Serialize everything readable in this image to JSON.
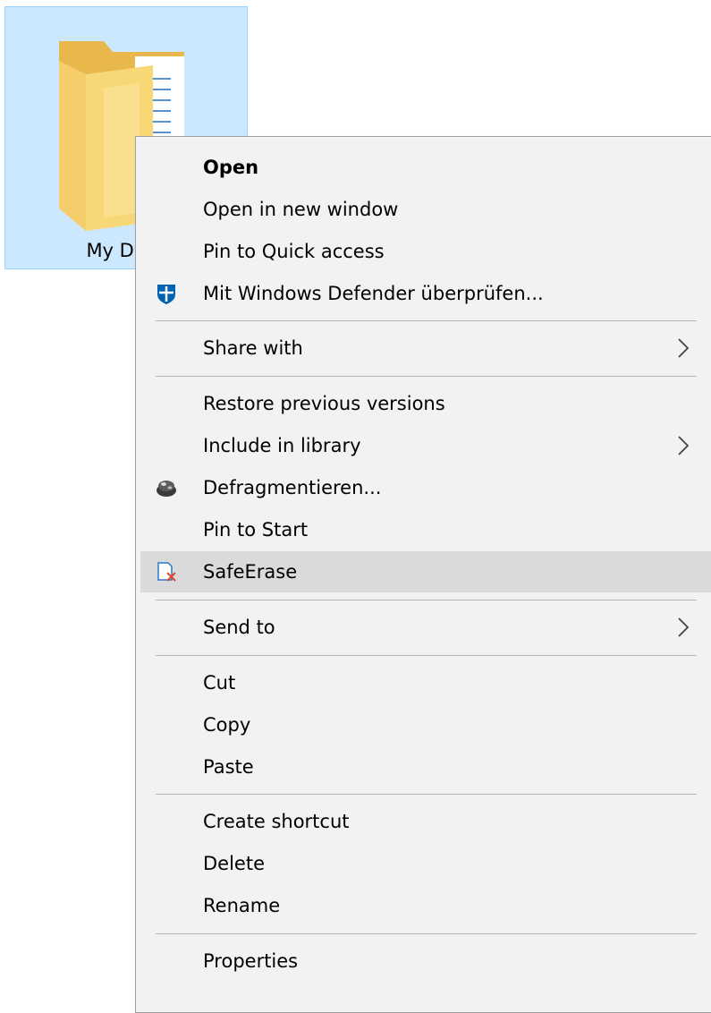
{
  "desktop": {
    "folder_label": "My Docu"
  },
  "context_menu": {
    "items": [
      {
        "id": "open",
        "label": "Open"
      },
      {
        "id": "open-new-window",
        "label": "Open in new window"
      },
      {
        "id": "pin-quick-access",
        "label": "Pin to Quick access"
      },
      {
        "id": "defender-scan",
        "label": "Mit Windows Defender überprüfen...",
        "icon": "windows-defender-shield-icon"
      },
      {
        "id": "share-with",
        "label": "Share with",
        "submenu": true
      },
      {
        "id": "restore-versions",
        "label": "Restore previous versions"
      },
      {
        "id": "include-library",
        "label": "Include in library",
        "submenu": true
      },
      {
        "id": "defragment",
        "label": "Defragmentieren...",
        "icon": "defrag-icon"
      },
      {
        "id": "pin-start",
        "label": "Pin to Start"
      },
      {
        "id": "safe-erase",
        "label": "SafeErase",
        "icon": "safeerase-icon",
        "highlighted": true
      },
      {
        "id": "send-to",
        "label": "Send to",
        "submenu": true
      },
      {
        "id": "cut",
        "label": "Cut"
      },
      {
        "id": "copy",
        "label": "Copy"
      },
      {
        "id": "paste",
        "label": "Paste"
      },
      {
        "id": "create-shortcut",
        "label": "Create shortcut"
      },
      {
        "id": "delete",
        "label": "Delete"
      },
      {
        "id": "rename",
        "label": "Rename"
      },
      {
        "id": "properties",
        "label": "Properties"
      }
    ]
  },
  "colors": {
    "selection_fill": "#cce8ff",
    "selection_border": "#99d1ff",
    "menu_background": "#f2f2f2",
    "menu_hover": "#dadada",
    "defender_blue": "#0063b1"
  }
}
